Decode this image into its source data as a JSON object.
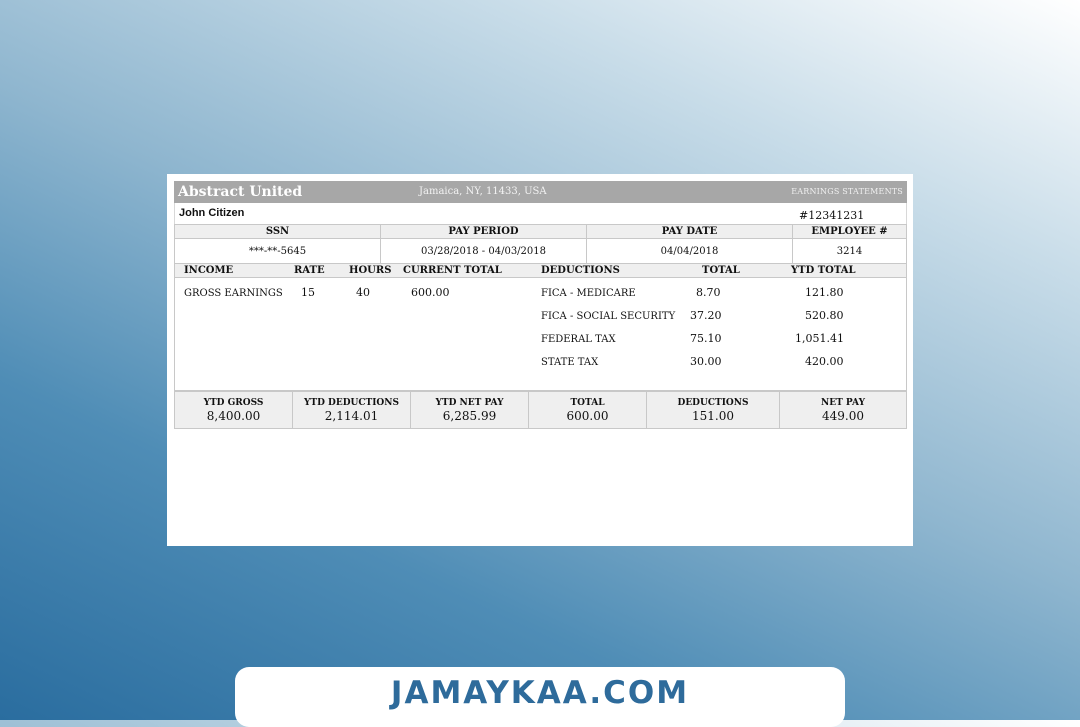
{
  "stub": {
    "company": "Abstract United",
    "address": "Jamaica, NY, 11433, USA",
    "statement_label": "EARNINGS STATEMENTS",
    "employee_name": "John Citizen",
    "employee_number_display": "#12341231"
  },
  "info": {
    "headers": [
      "SSN",
      "PAY PERIOD",
      "PAY DATE",
      "EMPLOYEE #"
    ],
    "values": [
      "***-**-5645",
      "03/28/2018 - 04/03/2018",
      "04/04/2018",
      "3214"
    ]
  },
  "columns": {
    "income": "INCOME",
    "rate": "RATE",
    "hours": "HOURS",
    "current_total": "CURRENT TOTAL",
    "deductions": "DEDUCTIONS",
    "total": "TOTAL",
    "ytd_total": "YTD TOTAL"
  },
  "earnings": {
    "label": "GROSS EARNINGS",
    "rate": "15",
    "hours": "40",
    "current_total": "600.00"
  },
  "deductions": [
    {
      "label": "FICA - MEDICARE",
      "total": "8.70",
      "ytd": "121.80"
    },
    {
      "label": "FICA - SOCIAL SECURITY",
      "total": "37.20",
      "ytd": "520.80"
    },
    {
      "label": "FEDERAL TAX",
      "total": "75.10",
      "ytd": "1,051.41"
    },
    {
      "label": "STATE TAX",
      "total": "30.00",
      "ytd": "420.00"
    }
  ],
  "totals": [
    {
      "label": "YTD GROSS",
      "value": "8,400.00"
    },
    {
      "label": "YTD DEDUCTIONS",
      "value": "2,114.01"
    },
    {
      "label": "YTD NET PAY",
      "value": "6,285.99"
    },
    {
      "label": "TOTAL",
      "value": "600.00"
    },
    {
      "label": "DEDUCTIONS",
      "value": "151.00"
    },
    {
      "label": "NET PAY",
      "value": "449.00"
    }
  ],
  "banner": {
    "site": "JAMAYKAA.COM"
  },
  "colors": {
    "header_gray": "#a7a7a7",
    "banner_text": "#2e6b9b"
  }
}
